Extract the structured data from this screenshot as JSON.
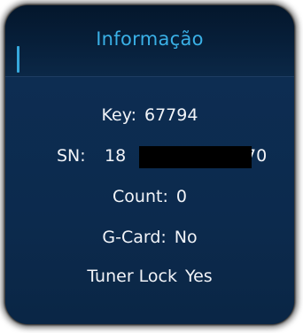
{
  "dialog": {
    "title": "Informação",
    "key_label": "Key:",
    "key_value": "67794",
    "sn_label": "SN:",
    "sn_visible_start": "18",
    "sn_visible_end": "70",
    "count_label": "Count:",
    "count_value": "0",
    "gcard_label": "G-Card:",
    "gcard_value": "No",
    "tuner_label": "Tuner Lock",
    "tuner_value": "Yes"
  },
  "colors": {
    "panel_background": "#0c2a4e",
    "header_background": "#071f3a",
    "title_color": "#3ab0e6",
    "text_color": "#f2f4f8",
    "redaction": "#000000"
  }
}
